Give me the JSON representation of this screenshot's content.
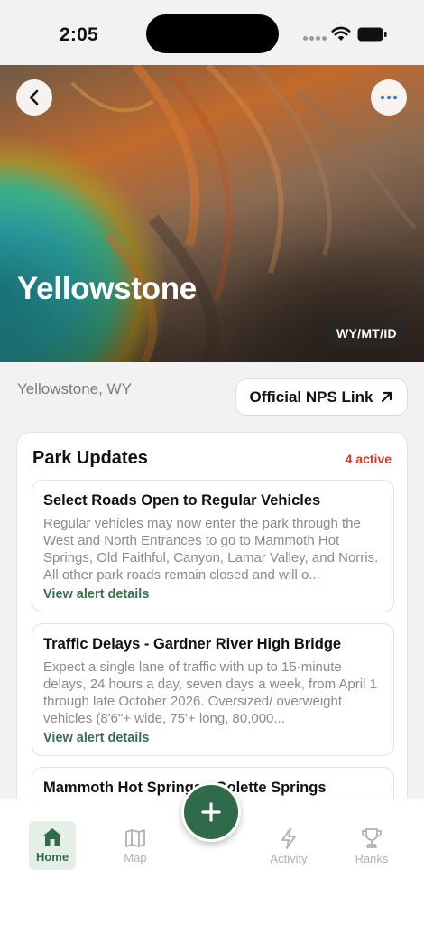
{
  "status_bar": {
    "time": "2:05"
  },
  "hero": {
    "title": "Yellowstone",
    "state_badge": "WY/MT/ID"
  },
  "park_info": {
    "location": "Yellowstone, WY",
    "nps_link_label": "Official NPS Link"
  },
  "updates": {
    "title": "Park Updates",
    "active_count": "4 active",
    "alerts": [
      {
        "title": "Select Roads Open to Regular Vehicles",
        "body": "Regular vehicles may now enter the park through the West and North Entrances to go to Mammoth Hot Springs, Old Faithful, Canyon, Lamar Valley, and Norris. All other park roads remain closed and will o...",
        "link": "View alert details"
      },
      {
        "title": "Traffic Delays - Gardner River High Bridge",
        "body": "Expect a single lane of traffic with up to 15-minute delays, 24 hours a day, seven days a week, from April 1 through late October 2026. Oversized/ overweight vehicles (8'6\"+ wide, 75'+ long, 80,000...",
        "link": "View alert details"
      },
      {
        "title": "Mammoth Hot Springs - Golette Springs",
        "body": "",
        "link": ""
      }
    ]
  },
  "tabs": [
    {
      "label": "Home",
      "icon": "house-icon",
      "active": true
    },
    {
      "label": "Map",
      "icon": "map-icon",
      "active": false
    },
    {
      "label": "Activity",
      "icon": "lightning-icon",
      "active": false
    },
    {
      "label": "Ranks",
      "icon": "trophy-icon",
      "active": false
    }
  ],
  "colors": {
    "accent": "#2f6b4a",
    "active_count": "#d03a2f",
    "link": "#3b6e50"
  }
}
